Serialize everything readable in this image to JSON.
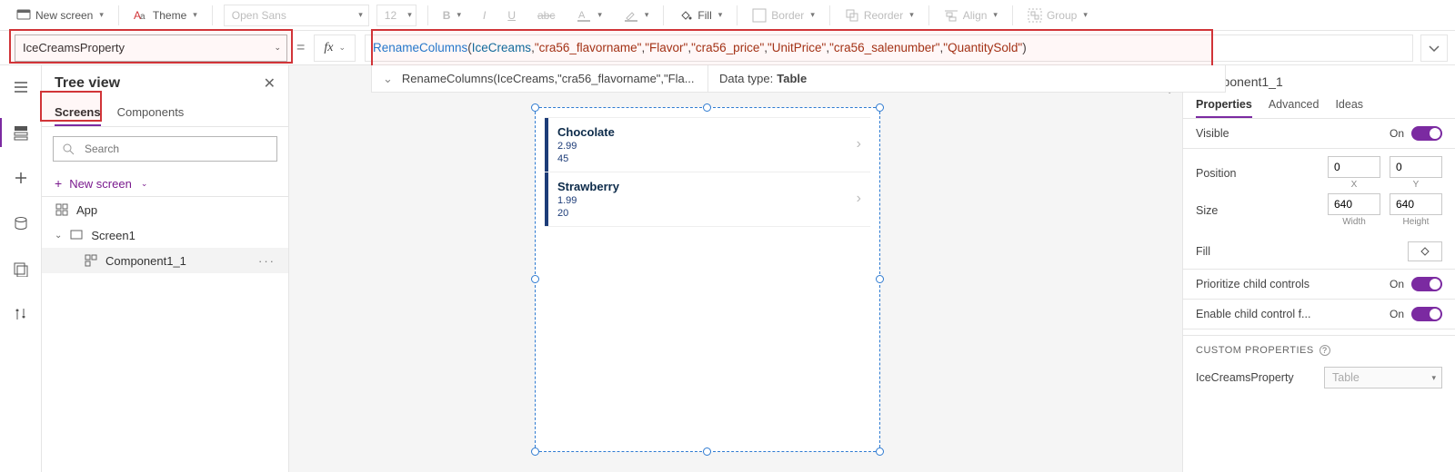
{
  "ribbon": {
    "newScreen": "New screen",
    "theme": "Theme",
    "font": "Open Sans",
    "fontSize": "12",
    "fill": "Fill",
    "border": "Border",
    "reorder": "Reorder",
    "align": "Align",
    "group": "Group"
  },
  "propertySelector": "IceCreamsProperty",
  "eq": "=",
  "fx": "fx",
  "formula": {
    "fn": "RenameColumns",
    "t1": "IceCreams",
    "s1": "\"cra56_flavorname\"",
    "s2": "\"Flavor\"",
    "s3": "\"cra56_price\"",
    "s4": "\"UnitPrice\"",
    "s5": "\"cra56_salenumber\"",
    "s6": "\"QuantitySold\"",
    "comma": ","
  },
  "hint": {
    "summary": "RenameColumns(IceCreams,\"cra56_flavorname\",\"Fla...",
    "dtLabel": "Data type:",
    "dtValue": "Table"
  },
  "tree": {
    "title": "Tree view",
    "tabScreens": "Screens",
    "tabComponents": "Components",
    "searchPlaceholder": "Search",
    "newScreen": "New screen",
    "app": "App",
    "screen1": "Screen1",
    "comp": "Component1_1"
  },
  "gallery": {
    "row1": {
      "title": "Chocolate",
      "p1": "2.99",
      "p2": "45"
    },
    "row2": {
      "title": "Strawberry",
      "p1": "1.99",
      "p2": "20"
    }
  },
  "rightPanel": {
    "title": "Component1_1",
    "tabProps": "Properties",
    "tabAdv": "Advanced",
    "tabIdeas": "Ideas",
    "visible": "Visible",
    "on": "On",
    "position": "Position",
    "posX": "0",
    "posY": "0",
    "xLabel": "X",
    "yLabel": "Y",
    "size": "Size",
    "w": "640",
    "h": "640",
    "wLabel": "Width",
    "hLabel": "Height",
    "fill": "Fill",
    "prio": "Prioritize child controls",
    "enable": "Enable child control f...",
    "custom": "CUSTOM PROPERTIES",
    "cpName": "IceCreamsProperty",
    "cpType": "Table"
  }
}
